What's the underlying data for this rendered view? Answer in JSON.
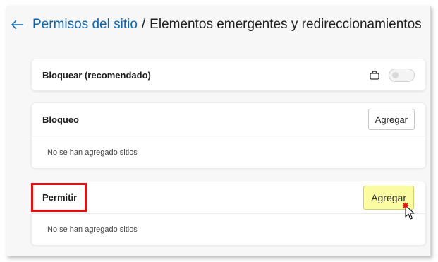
{
  "header": {
    "back_icon": "arrow-left-icon",
    "link": "Permisos del sitio",
    "separator": "/",
    "current": "Elementos emergentes y redireccionamientos"
  },
  "block_setting": {
    "label": "Bloquear (recomendado)",
    "icon": "briefcase-icon",
    "toggle_on": false
  },
  "bloqueo": {
    "title": "Bloqueo",
    "add_label": "Agregar",
    "empty_text": "No se han agregado sitios"
  },
  "permitir": {
    "title": "Permitir",
    "add_label": "Agregar",
    "empty_text": "No se han agregado sitios"
  },
  "colors": {
    "link": "#0b66b2",
    "highlight": "#fbfba2",
    "annotation_box": "#e01010",
    "click_marker": "#e01010"
  }
}
